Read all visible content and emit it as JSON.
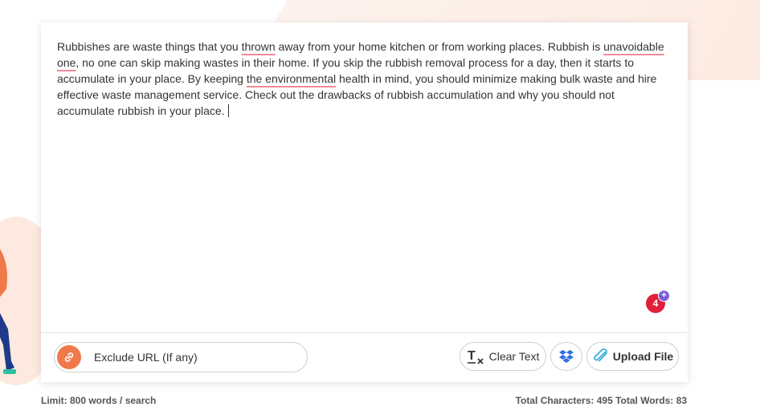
{
  "editor": {
    "segments": [
      {
        "text": "Rubbishes are waste things that you ",
        "underline": false
      },
      {
        "text": "thrown",
        "underline": true
      },
      {
        "text": " away from your home kitchen or from working places. Rubbish is ",
        "underline": false
      },
      {
        "text": "unavoidable one",
        "underline": true
      },
      {
        "text": ", no one can skip making wastes in their home. If you skip the rubbish removal process for a day, then it starts to accumulate in your place. By keeping ",
        "underline": false
      },
      {
        "text": "the environmental",
        "underline": true
      },
      {
        "text": " health in mind, you should minimize making bulk waste and hire effective waste management service. Check out the drawbacks of rubbish accumulation and why you should not accumulate rubbish in your place.",
        "underline": false
      }
    ],
    "issue_count": "4",
    "issue_plus": "+"
  },
  "toolbar": {
    "exclude_label": "Exclude URL (If any)",
    "clear_label": "Clear Text",
    "upload_label": "Upload File"
  },
  "footer": {
    "limit": "Limit: 800 words / search",
    "totals": "Total Characters: 495 Total Words: 83"
  },
  "colors": {
    "accent": "#f0794a",
    "badge": "#e0203a",
    "badge_plus": "#7b5fd6",
    "dropbox": "#2f6fe0",
    "upload_icon": "#3aaed8",
    "underline": "#f08a96"
  },
  "icons": {
    "exclude": "link-icon",
    "clear": "clear-format-icon",
    "dropbox": "dropbox-icon",
    "upload": "paperclip-icon"
  }
}
